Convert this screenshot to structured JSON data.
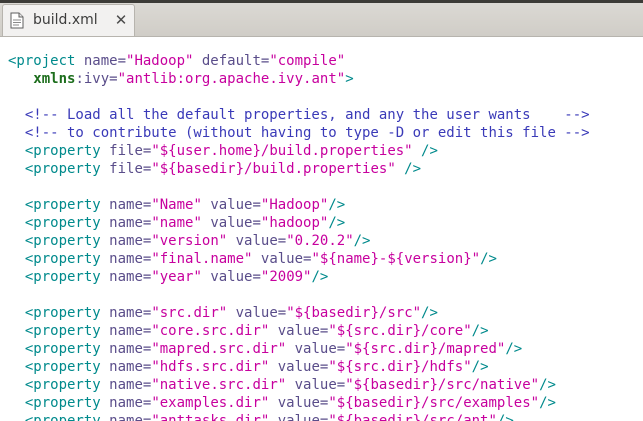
{
  "tab": {
    "title": "build.xml",
    "close_label": "✕",
    "icon": "text-file-icon"
  },
  "colors": {
    "tag": "#008a8c",
    "attribute": "#5a4d8a",
    "value": "#c7009e",
    "namespace": "#1d6e1d",
    "comment": "#3a3ab8"
  },
  "editor": {
    "lines": [
      [
        [
          "tag",
          "<project "
        ],
        [
          "attr",
          "name="
        ],
        [
          "val",
          "\"Hadoop\""
        ],
        [
          "attr",
          " default="
        ],
        [
          "val",
          "\"compile\""
        ]
      ],
      [
        [
          "plain",
          "   "
        ],
        [
          "ns",
          "xmlns"
        ],
        [
          "attr",
          ":ivy="
        ],
        [
          "val",
          "\"antlib:org.apache.ivy.ant\""
        ],
        [
          "tag",
          ">"
        ]
      ],
      [],
      [
        [
          "plain",
          "  "
        ],
        [
          "comment",
          "<!-- Load all the default properties, and any the user wants    -->"
        ]
      ],
      [
        [
          "plain",
          "  "
        ],
        [
          "comment",
          "<!-- to contribute (without having to type -D or edit this file -->"
        ]
      ],
      [
        [
          "plain",
          "  "
        ],
        [
          "tag",
          "<property "
        ],
        [
          "attr",
          "file="
        ],
        [
          "val",
          "\"${user.home}/build.properties\""
        ],
        [
          "tag",
          " />"
        ]
      ],
      [
        [
          "plain",
          "  "
        ],
        [
          "tag",
          "<property "
        ],
        [
          "attr",
          "file="
        ],
        [
          "val",
          "\"${basedir}/build.properties\""
        ],
        [
          "tag",
          " />"
        ]
      ],
      [],
      [
        [
          "plain",
          "  "
        ],
        [
          "tag",
          "<property "
        ],
        [
          "attr",
          "name="
        ],
        [
          "val",
          "\"Name\""
        ],
        [
          "attr",
          " value="
        ],
        [
          "val",
          "\"Hadoop\""
        ],
        [
          "tag",
          "/>"
        ]
      ],
      [
        [
          "plain",
          "  "
        ],
        [
          "tag",
          "<property "
        ],
        [
          "attr",
          "name="
        ],
        [
          "val",
          "\"name\""
        ],
        [
          "attr",
          " value="
        ],
        [
          "val",
          "\"hadoop\""
        ],
        [
          "tag",
          "/>"
        ]
      ],
      [
        [
          "plain",
          "  "
        ],
        [
          "tag",
          "<property "
        ],
        [
          "attr",
          "name="
        ],
        [
          "val",
          "\"version\""
        ],
        [
          "attr",
          " value="
        ],
        [
          "val",
          "\"0.20.2\""
        ],
        [
          "tag",
          "/>"
        ]
      ],
      [
        [
          "plain",
          "  "
        ],
        [
          "tag",
          "<property "
        ],
        [
          "attr",
          "name="
        ],
        [
          "val",
          "\"final.name\""
        ],
        [
          "attr",
          " value="
        ],
        [
          "val",
          "\"${name}-${version}\""
        ],
        [
          "tag",
          "/>"
        ]
      ],
      [
        [
          "plain",
          "  "
        ],
        [
          "tag",
          "<property "
        ],
        [
          "attr",
          "name="
        ],
        [
          "val",
          "\"year\""
        ],
        [
          "attr",
          " value="
        ],
        [
          "val",
          "\"2009\""
        ],
        [
          "tag",
          "/>"
        ]
      ],
      [],
      [
        [
          "plain",
          "  "
        ],
        [
          "tag",
          "<property "
        ],
        [
          "attr",
          "name="
        ],
        [
          "val",
          "\"src.dir\""
        ],
        [
          "attr",
          " value="
        ],
        [
          "val",
          "\"${basedir}/src\""
        ],
        [
          "tag",
          "/>"
        ]
      ],
      [
        [
          "plain",
          "  "
        ],
        [
          "tag",
          "<property "
        ],
        [
          "attr",
          "name="
        ],
        [
          "val",
          "\"core.src.dir\""
        ],
        [
          "attr",
          " value="
        ],
        [
          "val",
          "\"${src.dir}/core\""
        ],
        [
          "tag",
          "/>"
        ]
      ],
      [
        [
          "plain",
          "  "
        ],
        [
          "tag",
          "<property "
        ],
        [
          "attr",
          "name="
        ],
        [
          "val",
          "\"mapred.src.dir\""
        ],
        [
          "attr",
          " value="
        ],
        [
          "val",
          "\"${src.dir}/mapred\""
        ],
        [
          "tag",
          "/>"
        ]
      ],
      [
        [
          "plain",
          "  "
        ],
        [
          "tag",
          "<property "
        ],
        [
          "attr",
          "name="
        ],
        [
          "val",
          "\"hdfs.src.dir\""
        ],
        [
          "attr",
          " value="
        ],
        [
          "val",
          "\"${src.dir}/hdfs\""
        ],
        [
          "tag",
          "/>"
        ]
      ],
      [
        [
          "plain",
          "  "
        ],
        [
          "tag",
          "<property "
        ],
        [
          "attr",
          "name="
        ],
        [
          "val",
          "\"native.src.dir\""
        ],
        [
          "attr",
          " value="
        ],
        [
          "val",
          "\"${basedir}/src/native\""
        ],
        [
          "tag",
          "/>"
        ]
      ],
      [
        [
          "plain",
          "  "
        ],
        [
          "tag",
          "<property "
        ],
        [
          "attr",
          "name="
        ],
        [
          "val",
          "\"examples.dir\""
        ],
        [
          "attr",
          " value="
        ],
        [
          "val",
          "\"${basedir}/src/examples\""
        ],
        [
          "tag",
          "/>"
        ]
      ],
      [
        [
          "plain",
          "  "
        ],
        [
          "tag",
          "<property "
        ],
        [
          "attr",
          "name="
        ],
        [
          "val",
          "\"anttasks.dir\""
        ],
        [
          "attr",
          " value="
        ],
        [
          "val",
          "\"${basedir}/src/ant\""
        ],
        [
          "tag",
          "/>"
        ]
      ]
    ]
  }
}
